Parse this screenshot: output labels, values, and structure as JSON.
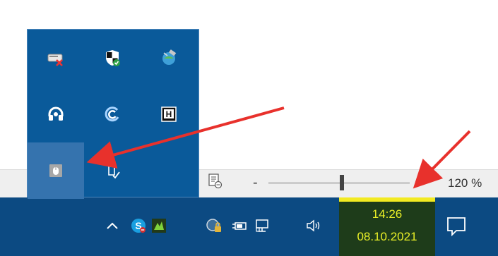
{
  "statusbar": {
    "zoom_minus": "-",
    "zoom_plus": "+",
    "zoom_percent": "120 %",
    "zoom_level_fraction": 0.5
  },
  "taskbar": {
    "clock": {
      "time": "14:26",
      "date": "08.10.2021"
    },
    "tray_icons": [
      "show-hidden-icons-chevron",
      "skype-icon",
      "green-app-icon",
      "network-locked-icon",
      "power-battery-icon",
      "network-monitor-icon",
      "volume-icon"
    ],
    "chevron_glyph": "^"
  },
  "flyout": {
    "items": [
      "network-disconnected-icon",
      "windows-security-icon",
      "satellite-app-icon",
      "headset-icon",
      "spinner-app-icon",
      "hotkey-app-icon",
      "usb-mouse-icon",
      "safely-remove-hardware-icon"
    ]
  },
  "colors": {
    "taskbar": "#0c4a82",
    "flyout": "#0a5a9a",
    "highlight": "#f2ea22",
    "clock_text": "#e9ef27",
    "arrow": "#e8312c"
  }
}
